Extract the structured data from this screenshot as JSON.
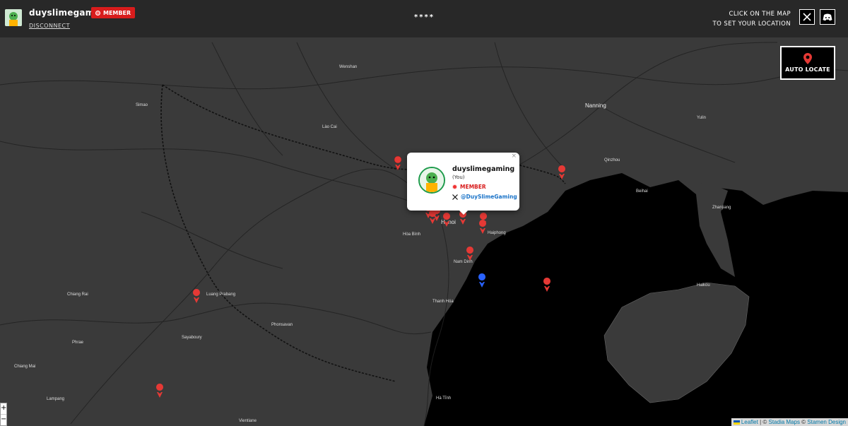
{
  "user": {
    "name": "duyslimegaming",
    "badge": "MEMBER",
    "disconnect": "DISCONNECT"
  },
  "header": {
    "center_text": "****",
    "hint_line1": "CLICK ON THE MAP",
    "hint_line2": "TO SET YOUR LOCATION"
  },
  "buttons": {
    "auto_locate": "AUTO LOCATE",
    "x_icon": "x-logo-icon",
    "discord_icon": "discord-icon"
  },
  "popup": {
    "name": "duyslimegaming",
    "you_label": "(You)",
    "badge": "MEMBER",
    "twitter_handle": "@DuySlimeGaming",
    "close": "×"
  },
  "zoom": {
    "in": "+",
    "out": "−"
  },
  "attribution": {
    "leaflet": "Leaflet",
    "sep1": " | © ",
    "stadia": "Stadia Maps",
    "sep2": " © ",
    "stamen": "Stamen Design"
  },
  "map_labels": {
    "nanning": "Nanning",
    "hanoi": "Hanoi",
    "haiphong": "Haiphong",
    "nam_dinh": "Nam Dinh",
    "hoa_binh": "Hòa Bình",
    "luang_prabang": "Luang Prabang",
    "sayaboury": "Sayaboury",
    "phonsavan": "Phonsavan",
    "chiang_rai": "Chiang Rai",
    "chiang_mai": "Chiang Mai",
    "lampang": "Lampang",
    "vientiane": "Vientiane",
    "lao_cai": "Lào Cai",
    "wenshan": "Wenshan",
    "simao": "Simao",
    "thanh_hoa": "Thanh Hóa",
    "yulin": "Yulin",
    "qinzhou": "Qinzhou",
    "beihai": "Beihai",
    "zhanjiang": "Zhanjiang",
    "haikou": "Haikou",
    "phrae": "Phrae",
    "ha_tinh": "Hà Tĩnh"
  },
  "colors": {
    "land": "#3a3a3a",
    "water": "#000000",
    "topbar": "#282828",
    "member_red": "#d81c1c",
    "marker_red": "#e53935",
    "marker_blue": "#2962ff",
    "link_blue": "#1a73c8"
  }
}
